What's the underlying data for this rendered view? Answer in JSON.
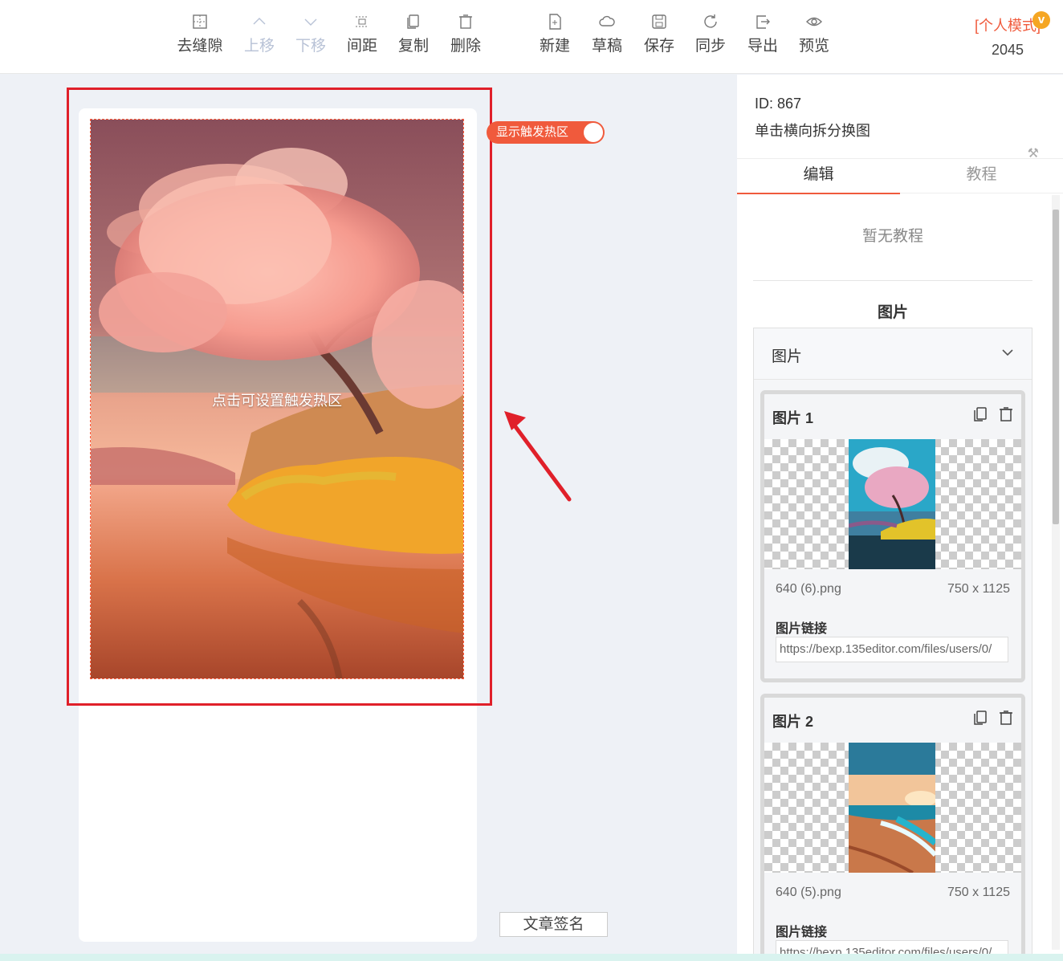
{
  "toolbar": {
    "items": [
      {
        "label": "去缝隙",
        "icon": "grid-icon",
        "enabled": true
      },
      {
        "label": "上移",
        "icon": "chevron-up-icon",
        "enabled": false
      },
      {
        "label": "下移",
        "icon": "chevron-down-icon",
        "enabled": false
      },
      {
        "label": "间距",
        "icon": "spacing-icon",
        "enabled": true
      },
      {
        "label": "复制",
        "icon": "copy-icon",
        "enabled": true
      },
      {
        "label": "删除",
        "icon": "trash-icon",
        "enabled": true
      },
      {
        "label": "新建",
        "icon": "new-file-icon",
        "enabled": true
      },
      {
        "label": "草稿",
        "icon": "cloud-icon",
        "enabled": true
      },
      {
        "label": "保存",
        "icon": "save-icon",
        "enabled": true
      },
      {
        "label": "同步",
        "icon": "sync-icon",
        "enabled": true
      },
      {
        "label": "导出",
        "icon": "export-icon",
        "enabled": true
      },
      {
        "label": "预览",
        "icon": "eye-icon",
        "enabled": true
      }
    ],
    "mode_label": "[个人模式]",
    "vip_badge": "v",
    "user_number": "2045"
  },
  "canvas": {
    "hotzone_text": "点击可设置触发热区",
    "toggle_label": "显示触发热区",
    "toggle_on": true,
    "sign_button": "文章签名"
  },
  "panel": {
    "id_text": "ID: 867",
    "name": "单击横向拆分换图",
    "tabs": [
      {
        "label": "编辑",
        "active": true
      },
      {
        "label": "教程",
        "active": false
      }
    ],
    "no_tutorial": "暂无教程",
    "section_title": "图片",
    "group_title": "图片",
    "items": [
      {
        "title": "图片 1",
        "filename": "640 (6).png",
        "size": "750 x 1125",
        "link_label": "图片链接",
        "link": "https://bexp.135editor.com/files/users/0/"
      },
      {
        "title": "图片 2",
        "filename": "640 (5).png",
        "size": "750 x 1125",
        "link_label": "图片链接",
        "link": "https://bexp.135editor.com/files/users/0/"
      }
    ]
  },
  "colors": {
    "accent": "#f05a3c",
    "frame_red": "#e0202a",
    "bg": "#eef1f6"
  }
}
